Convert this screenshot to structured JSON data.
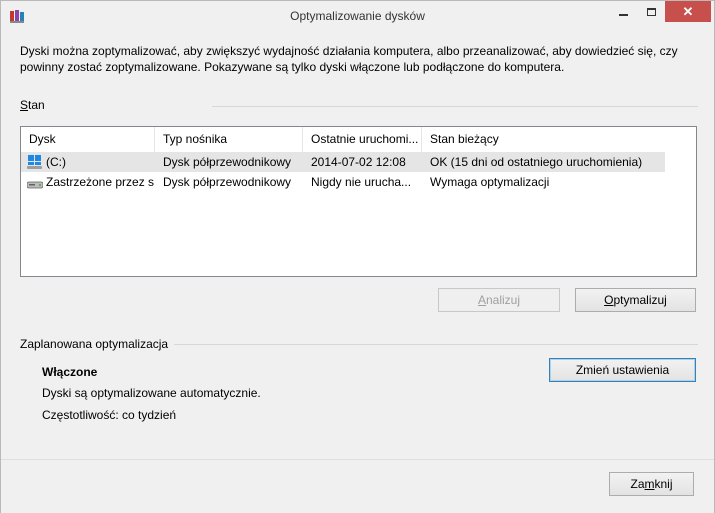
{
  "window": {
    "title": "Optymalizowanie dysków",
    "close_glyph": "✕"
  },
  "description": "Dyski można zoptymalizować, aby zwiększyć wydajność działania komputera, albo przeanalizować, aby dowiedzieć się, czy powinny zostać zoptymalizowane. Pokazywane są tylko dyski włączone lub podłączone do komputera.",
  "status_group": {
    "label_accel": "S",
    "label_rest": "tan"
  },
  "drive_list": {
    "columns": [
      "Dysk",
      "Typ nośnika",
      "Ostatnie uruchomi...",
      "Stan bieżący"
    ],
    "rows": [
      {
        "icon": "windows-drive-icon",
        "name": "(C:)",
        "media": "Dysk półprzewodnikowy",
        "last_run": "2014-07-02 12:08",
        "status": "OK (15 dni od ostatniego uruchomienia)",
        "selected": true
      },
      {
        "icon": "hard-drive-icon",
        "name": "Zastrzeżone przez s...",
        "media": "Dysk półprzewodnikowy",
        "last_run": "Nigdy nie urucha...",
        "status": "Wymaga optymalizacji",
        "selected": false
      }
    ]
  },
  "actions": {
    "analyze_accel": "A",
    "analyze_rest": "nalizuj",
    "optimize_accel": "O",
    "optimize_rest": "ptymalizuj"
  },
  "scheduled": {
    "label": "Zaplanowana optymalizacja",
    "state": "Włączone",
    "auto_text": "Dyski są optymalizowane automatycznie.",
    "frequency": "Częstotliwość: co tydzień",
    "change_button": "Zmień ustawienia"
  },
  "footer": {
    "close_pre": "Za",
    "close_accel": "m",
    "close_post": "knij"
  },
  "colors": {
    "close_button": "#c7504c",
    "selection": "#e5e5e5",
    "focus_border": "#3c7fb1"
  }
}
